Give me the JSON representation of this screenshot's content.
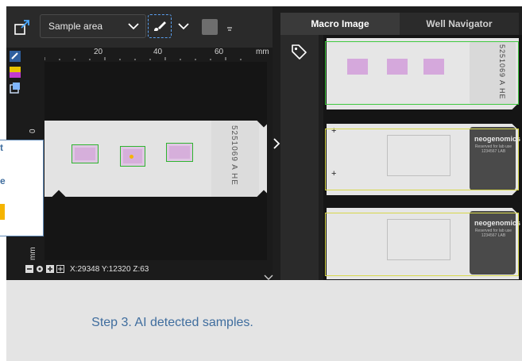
{
  "toolbar": {
    "sample_select_value": "Sample area"
  },
  "ruler": {
    "ticks": [
      "20",
      "40",
      "60"
    ],
    "unit": "mm",
    "vertical_zero": "0",
    "vertical_unit": "mm"
  },
  "slide": {
    "id_text": "5251069 A HE",
    "sample_count": 3
  },
  "status": {
    "coords": "X:29348 Y:12320 Z:63"
  },
  "right_pane": {
    "tabs": [
      {
        "label": "Macro Image",
        "active": true
      },
      {
        "label": "Well Navigator",
        "active": false
      }
    ],
    "slides": [
      {
        "label_text": "5251069 A HE",
        "frame": "green"
      },
      {
        "brand": "neogenomics",
        "sub": "Reserved for lab use 1234567 LAB",
        "frame": "yellow"
      },
      {
        "brand": "neogenomics",
        "sub": "Reserved for lab use 1234567 LAB",
        "frame": "yellow"
      }
    ]
  },
  "tooltip": {
    "lines": [
      "t",
      "e"
    ]
  },
  "caption": "Step 3. AI detected samples.",
  "colors": {
    "accent_blue": "#3f6d9e",
    "detect_green": "#2fb42f",
    "detect_yellow": "#d8d84a",
    "highlight": "#f5b400"
  },
  "icons": {
    "fit": "fit-view-icon",
    "draw": "draw-region-icon",
    "tag": "tag-icon",
    "expand": "chevron-right-icon",
    "collapse": "chevron-down-icon"
  }
}
